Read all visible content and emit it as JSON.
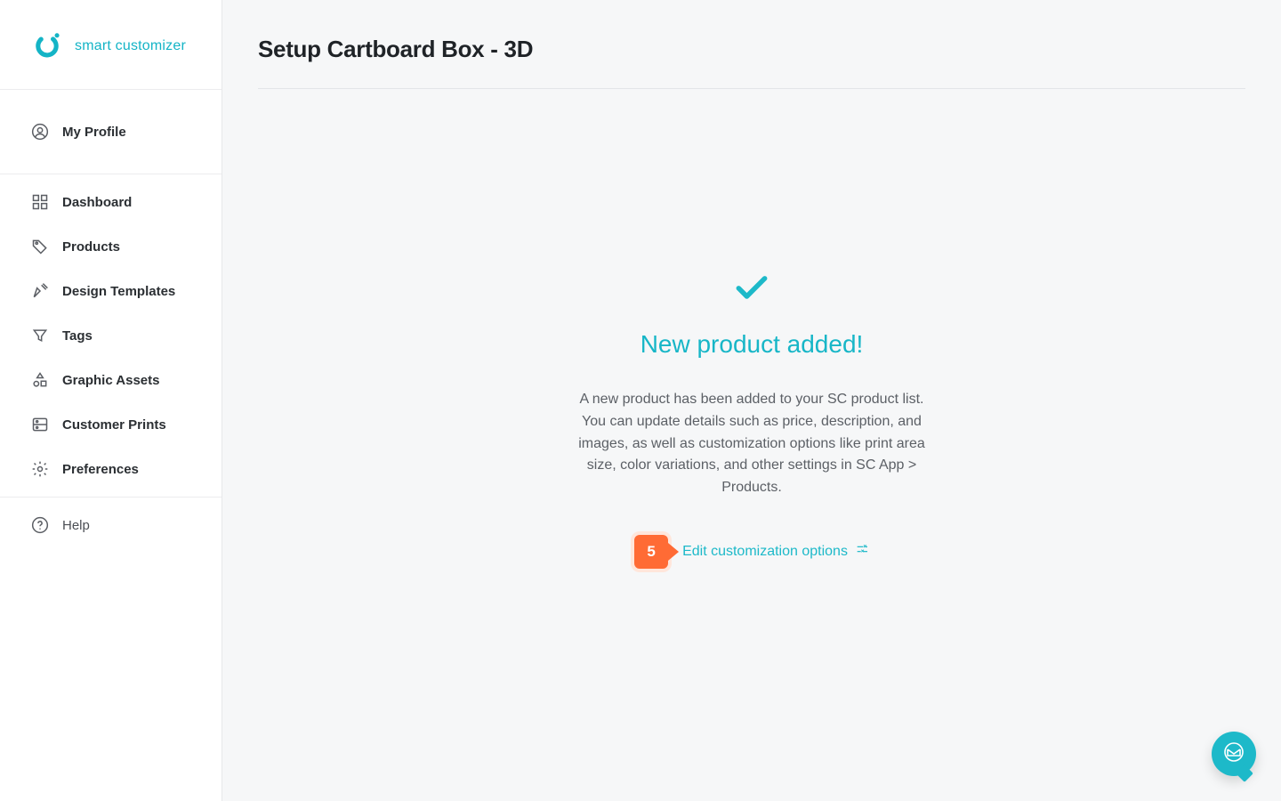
{
  "brand": {
    "name": "smart customizer"
  },
  "sidebar": {
    "profile_label": "My Profile",
    "items": [
      {
        "label": "Dashboard"
      },
      {
        "label": "Products"
      },
      {
        "label": "Design Templates"
      },
      {
        "label": "Tags"
      },
      {
        "label": "Graphic Assets"
      },
      {
        "label": "Customer Prints"
      },
      {
        "label": "Preferences"
      }
    ],
    "help_label": "Help"
  },
  "page": {
    "title": "Setup Cartboard Box - 3D"
  },
  "success": {
    "title": "New product added!",
    "body": "A new product has been added to your SC product list. You can update details such as price, description, and images, as well as customization options like print area size, color variations, and other settings in SC App > Products."
  },
  "cta": {
    "step_number": "5",
    "link_label": "Edit customization options"
  },
  "colors": {
    "accent": "#1db9c9",
    "brand": "#14b4c6",
    "cta_orange": "#ff6b35",
    "text_muted": "#5c6066"
  }
}
